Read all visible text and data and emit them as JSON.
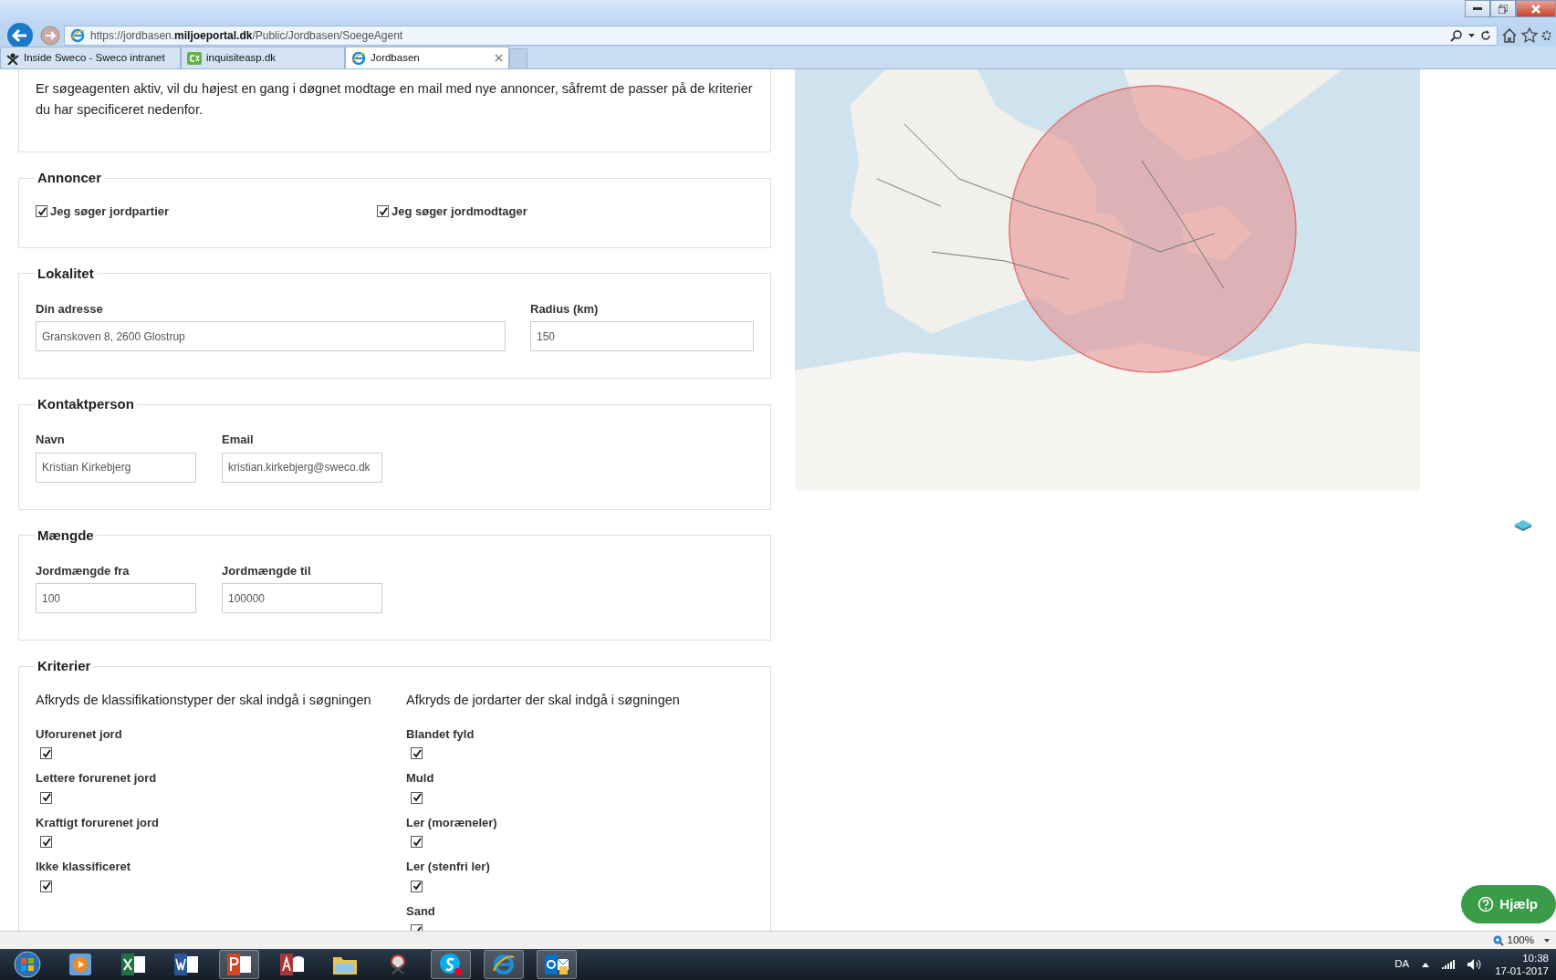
{
  "browser": {
    "address": "https://jordbasen.**miljoeportal.dk**/Public/Jordbasen/SoegeAgent",
    "tabs": [
      {
        "label": "Inside Sweco - Sweco intranet",
        "selected": false
      },
      {
        "label": "inquisiteasp.dk",
        "selected": false
      },
      {
        "label": "Jordbasen",
        "selected": true
      }
    ],
    "zoom": "100%"
  },
  "page": {
    "intro": "Er søgeagenten aktiv, vil du højest en gang i døgnet modtage en mail med nye annoncer, såfremt de passer på de kriterier du har specificeret nedenfor.",
    "annoncer": {
      "legend": "Annoncer",
      "options": [
        {
          "label": "Jeg søger jordpartier",
          "checked": true
        },
        {
          "label": "Jeg søger jordmodtager",
          "checked": true
        }
      ]
    },
    "lokalitet": {
      "legend": "Lokalitet",
      "fields": [
        {
          "label": "Din adresse",
          "value": "Granskoven 8, 2600 Glostrup"
        },
        {
          "label": "Radius (km)",
          "value": "150"
        }
      ]
    },
    "kontaktperson": {
      "legend": "Kontaktperson",
      "fields": [
        {
          "label": "Navn",
          "value": "Kristian Kirkebjerg"
        },
        {
          "label": "Email",
          "value": "kristian.kirkebjerg@sweco.dk"
        }
      ]
    },
    "maengde": {
      "legend": "Mængde",
      "fields": [
        {
          "label": "Jordmængde fra",
          "value": "100"
        },
        {
          "label": "Jordmængde til",
          "value": "100000"
        }
      ]
    },
    "kriterier": {
      "legend": "Kriterier",
      "columns": [
        {
          "heading": "Afkryds de klassifikationstyper der skal indgå i søgningen",
          "items": [
            {
              "label": "Uforurenet jord",
              "checked": true
            },
            {
              "label": "Lettere forurenet jord",
              "checked": true
            },
            {
              "label": "Kraftigt forurenet jord",
              "checked": true
            },
            {
              "label": "Ikke klassificeret",
              "checked": true
            }
          ]
        },
        {
          "heading": "Afkryds de jordarter der skal indgå i søgningen",
          "items": [
            {
              "label": "Blandet fyld",
              "checked": true
            },
            {
              "label": "Muld",
              "checked": true
            },
            {
              "label": "Ler (moræneler)",
              "checked": true
            },
            {
              "label": "Ler (stenfri ler)",
              "checked": true
            },
            {
              "label": "Sand",
              "checked": true
            }
          ]
        }
      ]
    },
    "help_button": "Hjælp"
  },
  "taskbar": {
    "language": "DA",
    "time": "10:38",
    "date": "17-01-2017"
  }
}
